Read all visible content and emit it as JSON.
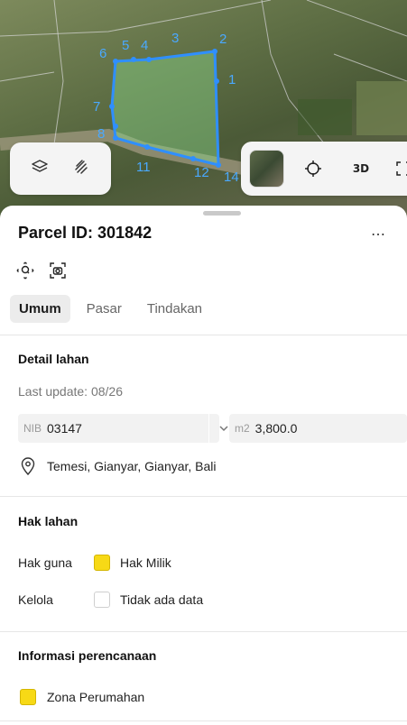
{
  "map": {
    "vertex_labels": [
      "6",
      "5",
      "4",
      "3",
      "2",
      "1",
      "7",
      "8",
      "11",
      "12",
      "14"
    ],
    "parcel_color": "#2f8fff",
    "thumbnail_icon": "satellite-thumbnail",
    "label_3d": "3D"
  },
  "sheet": {
    "title": "Parcel ID: 301842",
    "more_label": "⋯",
    "tabs": [
      "Umum",
      "Pasar",
      "Tindakan"
    ],
    "active_tab": "Umum"
  },
  "detail": {
    "title": "Detail lahan",
    "last_update": "Last update: 08/26",
    "nib_prefix": "NIB",
    "nib_value": "03147",
    "area_unit": "m2",
    "area_value": "3,800.0",
    "address": "Temesi, Gianyar, Gianyar, Bali"
  },
  "rights": {
    "title": "Hak lahan",
    "rows": [
      {
        "label": "Hak guna",
        "value": "Hak Milik",
        "color": "#f7d916"
      },
      {
        "label": "Kelola",
        "value": "Tidak ada data",
        "color": "#ffffff"
      }
    ]
  },
  "planning": {
    "title": "Informasi perencanaan",
    "zone": "Zona Perumahan",
    "zone_color": "#f7d916"
  }
}
